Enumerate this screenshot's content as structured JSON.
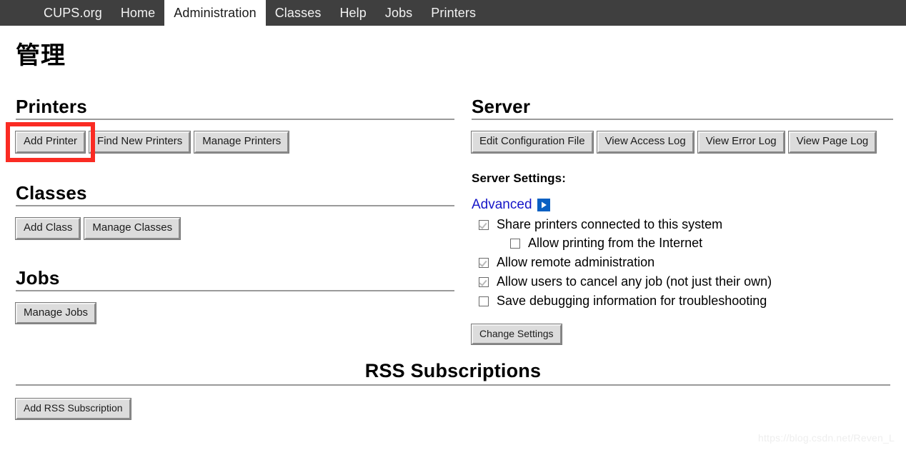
{
  "nav": {
    "items": [
      {
        "label": "CUPS.org",
        "active": false
      },
      {
        "label": "Home",
        "active": false
      },
      {
        "label": "Administration",
        "active": true
      },
      {
        "label": "Classes",
        "active": false
      },
      {
        "label": "Help",
        "active": false
      },
      {
        "label": "Jobs",
        "active": false
      },
      {
        "label": "Printers",
        "active": false
      }
    ]
  },
  "page": {
    "title": "管理"
  },
  "printers": {
    "heading": "Printers",
    "buttons": [
      {
        "label": "Add Printer",
        "highlighted": true
      },
      {
        "label": "Find New Printers",
        "highlighted": false
      },
      {
        "label": "Manage Printers",
        "highlighted": false
      }
    ]
  },
  "classes": {
    "heading": "Classes",
    "buttons": [
      {
        "label": "Add Class"
      },
      {
        "label": "Manage Classes"
      }
    ]
  },
  "jobs": {
    "heading": "Jobs",
    "buttons": [
      {
        "label": "Manage Jobs"
      }
    ]
  },
  "server": {
    "heading": "Server",
    "buttons": [
      {
        "label": "Edit Configuration File"
      },
      {
        "label": "View Access Log"
      },
      {
        "label": "View Error Log"
      },
      {
        "label": "View Page Log"
      }
    ],
    "settings_title": "Server Settings:",
    "advanced_label": "Advanced",
    "options": [
      {
        "label": "Share printers connected to this system",
        "checked": true,
        "indent": false
      },
      {
        "label": "Allow printing from the Internet",
        "checked": false,
        "indent": true
      },
      {
        "label": "Allow remote administration",
        "checked": true,
        "indent": false
      },
      {
        "label": "Allow users to cancel any job (not just their own)",
        "checked": true,
        "indent": false
      },
      {
        "label": "Save debugging information for troubleshooting",
        "checked": false,
        "indent": false
      }
    ],
    "change_settings_label": "Change Settings"
  },
  "rss": {
    "heading": "RSS Subscriptions",
    "add_label": "Add RSS Subscription"
  },
  "watermark": "https://blog.csdn.net/Reven_L",
  "colors": {
    "nav_bg": "#3f3f3f",
    "annotation": "#fa2b23",
    "link": "#1616c8",
    "toggle": "#0a60c2"
  }
}
